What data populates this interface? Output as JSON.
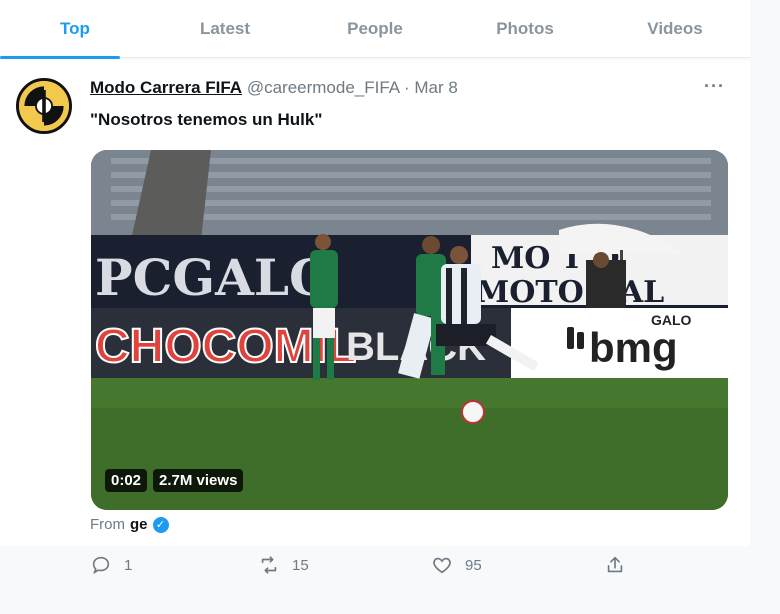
{
  "tabs": [
    {
      "label": "Top",
      "active": true
    },
    {
      "label": "Latest"
    },
    {
      "label": "People"
    },
    {
      "label": "Photos"
    },
    {
      "label": "Videos"
    }
  ],
  "tweet": {
    "author_name": "Modo Carrera FIFA",
    "handle": "@careermode_FIFA",
    "separator": "·",
    "date": "Mar 8",
    "more_label": "···",
    "text": "\"Nosotros tenemos un Hulk\"",
    "video": {
      "duration": "0:02",
      "views": "2.7M views",
      "boards": {
        "upper_left": "PCGALO",
        "upper_right_top": "MO  T  O",
        "upper_right_bottom": "MOTO  GAL",
        "chocomilk": "CHOCOMIL",
        "black": "BLACK",
        "galo": "GALO",
        "bmg": "bmg"
      }
    },
    "from_label": "From",
    "from_source": "ge",
    "stats": {
      "replies": "1",
      "retweets": "15",
      "likes": "95"
    }
  },
  "colors": {
    "accent": "#1d9bf0",
    "muted": "#6f7a83",
    "pitch": "#3f6e2a"
  }
}
